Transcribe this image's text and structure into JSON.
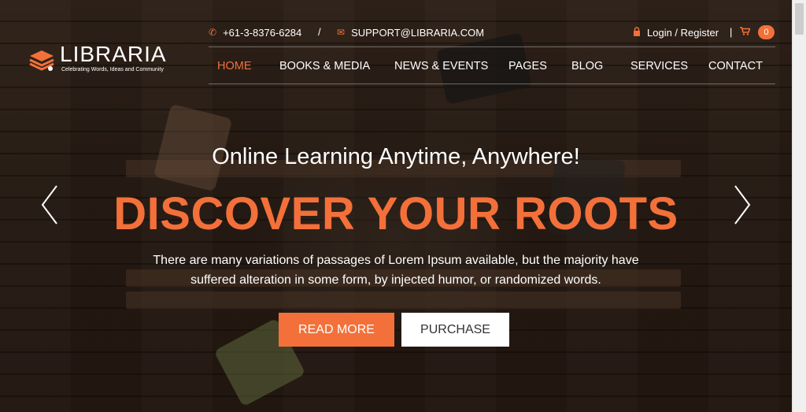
{
  "brand": {
    "name": "LIBRARIA",
    "tagline": "Celebrating Words, Ideas and Community",
    "accent_color": "#f3703a"
  },
  "topbar": {
    "phone_icon": "phone-icon",
    "phone": "+61-3-8376-6284",
    "separator": "/",
    "email_icon": "envelope-icon",
    "email": "SUPPORT@LIBRARIA.COM",
    "lock_icon": "lock-icon",
    "login_label": "Login / Register",
    "pipe": "|",
    "cart_icon": "cart-icon",
    "cart_count": "0"
  },
  "nav": {
    "items": [
      {
        "label": "HOME",
        "active": true
      },
      {
        "label": "BOOKS & MEDIA",
        "active": false
      },
      {
        "label": "NEWS & EVENTS",
        "active": false
      },
      {
        "label": "PAGES",
        "active": false
      },
      {
        "label": "BLOG",
        "active": false
      },
      {
        "label": "SERVICES",
        "active": false
      },
      {
        "label": "CONTACT",
        "active": false
      }
    ]
  },
  "slider": {
    "subtitle": "Online Learning Anytime, Anywhere!",
    "headline": "DISCOVER YOUR ROOTS",
    "description_line1": "There are many variations of passages of Lorem Ipsum available, but the majority have",
    "description_line2": "suffered alteration in some form, by injected humor, or randomized words.",
    "primary_button": "READ MORE",
    "secondary_button": "PURCHASE",
    "prev_icon": "chevron-left-icon",
    "next_icon": "chevron-right-icon"
  }
}
